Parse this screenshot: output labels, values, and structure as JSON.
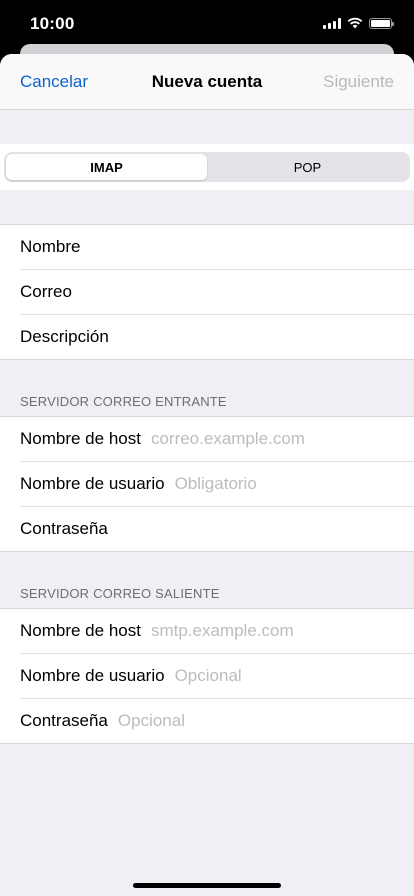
{
  "status_bar": {
    "time": "10:00"
  },
  "nav": {
    "cancel": "Cancelar",
    "title": "Nueva cuenta",
    "next": "Siguiente"
  },
  "segment": {
    "imap": "IMAP",
    "pop": "POP",
    "selected": "IMAP"
  },
  "account_fields": [
    "Nombre",
    "Correo",
    "Descripción"
  ],
  "incoming": {
    "header": "SERVIDOR CORREO ENTRANTE",
    "host_label": "Nombre de host",
    "host_placeholder": "correo.example.com",
    "user_label": "Nombre de usuario",
    "user_placeholder": "Obligatorio",
    "password_label": "Contraseña"
  },
  "outgoing": {
    "header": "SERVIDOR CORREO SALIENTE",
    "host_label": "Nombre de host",
    "host_placeholder": "smtp.example.com",
    "user_label": "Nombre de usuario",
    "user_placeholder": "Opcional",
    "password_label": "Contraseña",
    "password_placeholder": "Opcional"
  },
  "colors": {
    "accent": "#0a64c8",
    "disabled": "#b8b8bd",
    "placeholder": "#bcbcc1",
    "background": "#efeff4"
  }
}
